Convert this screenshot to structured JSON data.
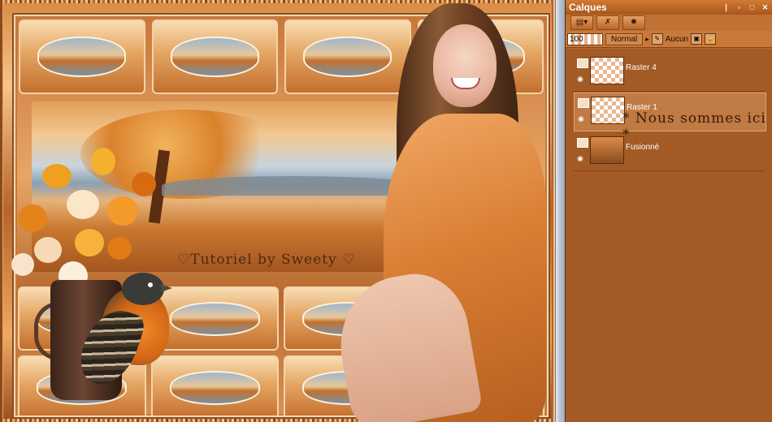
{
  "canvas": {
    "watermark": "♡Tutoriel by Sweety ♡"
  },
  "palette": {
    "title": "Calques",
    "window_buttons": [
      "❘",
      "▫",
      "□",
      "✕"
    ],
    "toolbar_buttons": [
      "▤▾",
      "✗",
      "✹"
    ],
    "opacity": "100",
    "blend_mode": "Normal",
    "lock_label": "Aucun",
    "layers": [
      {
        "name": "Raster 4",
        "selected": false
      },
      {
        "name": "Raster 1",
        "selected": true
      },
      {
        "name": "Fusionné",
        "selected": false
      }
    ],
    "annotation": "* Nous sommes ici *"
  }
}
